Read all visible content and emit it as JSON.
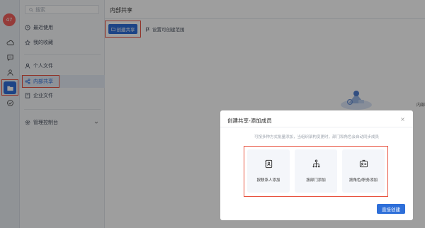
{
  "rail": {
    "badge": "47",
    "icons": [
      "cloud-icon",
      "chat-icon",
      "contacts-icon",
      "folder-icon",
      "check-icon"
    ]
  },
  "sidebar": {
    "search_placeholder": "搜索",
    "items": [
      {
        "label": "最近使用",
        "icon": "clock-icon"
      },
      {
        "label": "我的收藏",
        "icon": "star-icon"
      },
      {
        "label": "个人文件",
        "icon": "person-icon"
      },
      {
        "label": "内部共享",
        "icon": "share-icon",
        "active": true
      },
      {
        "label": "企业文件",
        "icon": "building-icon"
      },
      {
        "label": "管理控制台",
        "icon": "settings-icon"
      }
    ]
  },
  "main": {
    "title": "内部共享",
    "create_button": "创建共享",
    "scope_button": "设置可创建范围",
    "edge_text": "内部"
  },
  "dialog": {
    "title": "创建共享-添加成员",
    "hint": "可按多种方式批量添加，当组织架构变更时，部门和角色会自动同步成员",
    "options": [
      {
        "label": "按联系人添加",
        "icon": "contact-card-icon"
      },
      {
        "label": "按部门添加",
        "icon": "org-chart-icon"
      },
      {
        "label": "按角色/职务添加",
        "icon": "role-badge-icon"
      }
    ],
    "next_button": "直接创建"
  },
  "colors": {
    "accent": "#2e6fd9",
    "highlight": "#e8523f",
    "badge": "#f0605d"
  }
}
